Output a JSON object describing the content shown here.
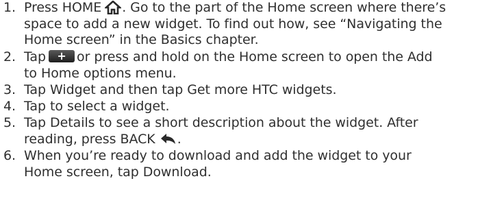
{
  "steps": [
    {
      "num": "1.",
      "lines": [
        [
          "Press HOME",
          ". Go to the part of the Home screen where there’s"
        ],
        "space to add a new widget. To find out how, see “Navigating the",
        "Home screen” in the Basics chapter."
      ]
    },
    {
      "num": "2.",
      "lines": [
        [
          "Tap",
          "or press and hold on the Home screen to open the Add"
        ],
        "to Home options menu."
      ]
    },
    {
      "num": "3.",
      "lines": [
        [
          "Tap ",
          "Widget",
          " and then tap ",
          "Get more HTC widgets",
          "."
        ]
      ]
    },
    {
      "num": "4.",
      "lines": [
        "Tap to select a widget."
      ]
    },
    {
      "num": "5.",
      "lines": [
        [
          "Tap ",
          "Details",
          " to see a short description about the widget. After"
        ],
        [
          "reading, press BACK",
          "."
        ]
      ]
    },
    {
      "num": "6.",
      "lines": [
        "When you’re ready to download and add the widget to your",
        [
          "Home screen, tap ",
          "Download",
          "."
        ]
      ]
    }
  ],
  "icons": {
    "home": "home-icon",
    "add": "add-button-icon",
    "back": "back-arrow-icon"
  }
}
